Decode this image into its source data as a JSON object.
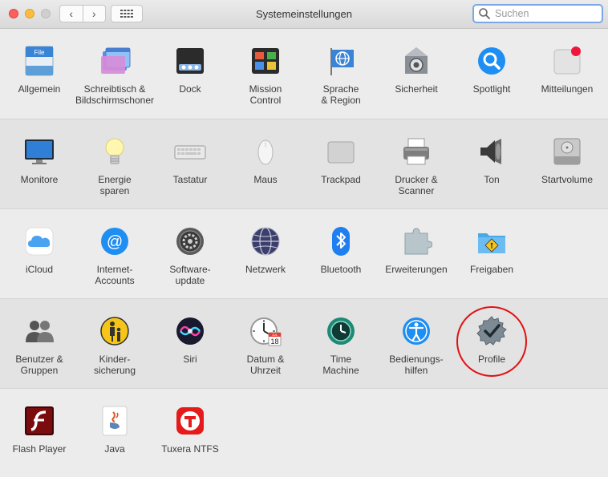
{
  "window": {
    "title": "Systemeinstellungen",
    "back_glyph": "‹",
    "forward_glyph": "›"
  },
  "search": {
    "placeholder": "Suchen",
    "value": ""
  },
  "rows": [
    {
      "items": [
        {
          "name": "allgemein",
          "icon": "general-icon",
          "line1": "Allgemein",
          "line2": ""
        },
        {
          "name": "schreibtisch",
          "icon": "desktop-screensaver-icon",
          "line1": "Schreibtisch &",
          "line2": "Bildschirmschoner"
        },
        {
          "name": "dock",
          "icon": "dock-icon",
          "line1": "Dock",
          "line2": ""
        },
        {
          "name": "mission-control",
          "icon": "mission-control-icon",
          "line1": "Mission",
          "line2": "Control"
        },
        {
          "name": "sprache-region",
          "icon": "language-region-icon",
          "line1": "Sprache",
          "line2": "& Region"
        },
        {
          "name": "sicherheit",
          "icon": "security-icon",
          "line1": "Sicherheit",
          "line2": ""
        },
        {
          "name": "spotlight",
          "icon": "spotlight-icon",
          "line1": "Spotlight",
          "line2": ""
        },
        {
          "name": "mitteilungen",
          "icon": "notifications-icon",
          "line1": "Mitteilungen",
          "line2": ""
        }
      ]
    },
    {
      "items": [
        {
          "name": "monitore",
          "icon": "displays-icon",
          "line1": "Monitore",
          "line2": ""
        },
        {
          "name": "energie-sparen",
          "icon": "energy-saver-icon",
          "line1": "Energie",
          "line2": "sparen"
        },
        {
          "name": "tastatur",
          "icon": "keyboard-icon",
          "line1": "Tastatur",
          "line2": ""
        },
        {
          "name": "maus",
          "icon": "mouse-icon",
          "line1": "Maus",
          "line2": ""
        },
        {
          "name": "trackpad",
          "icon": "trackpad-icon",
          "line1": "Trackpad",
          "line2": ""
        },
        {
          "name": "drucker-scanner",
          "icon": "printer-icon",
          "line1": "Drucker &",
          "line2": "Scanner"
        },
        {
          "name": "ton",
          "icon": "sound-icon",
          "line1": "Ton",
          "line2": ""
        },
        {
          "name": "startvolume",
          "icon": "startup-disk-icon",
          "line1": "Startvolume",
          "line2": ""
        }
      ]
    },
    {
      "items": [
        {
          "name": "icloud",
          "icon": "icloud-icon",
          "line1": "iCloud",
          "line2": ""
        },
        {
          "name": "internet-accounts",
          "icon": "internet-accounts-icon",
          "line1": "Internet-",
          "line2": "Accounts"
        },
        {
          "name": "software-update",
          "icon": "software-update-icon",
          "line1": "Software-",
          "line2": "update"
        },
        {
          "name": "netzwerk",
          "icon": "network-icon",
          "line1": "Netzwerk",
          "line2": ""
        },
        {
          "name": "bluetooth",
          "icon": "bluetooth-icon",
          "line1": "Bluetooth",
          "line2": ""
        },
        {
          "name": "erweiterungen",
          "icon": "extensions-icon",
          "line1": "Erweiterungen",
          "line2": ""
        },
        {
          "name": "freigaben",
          "icon": "sharing-icon",
          "line1": "Freigaben",
          "line2": ""
        }
      ]
    },
    {
      "items": [
        {
          "name": "benutzer-gruppen",
          "icon": "users-groups-icon",
          "line1": "Benutzer &",
          "line2": "Gruppen"
        },
        {
          "name": "kindersicherung",
          "icon": "parental-controls-icon",
          "line1": "Kinder-",
          "line2": "sicherung"
        },
        {
          "name": "siri",
          "icon": "siri-icon",
          "line1": "Siri",
          "line2": ""
        },
        {
          "name": "datum-uhrzeit",
          "icon": "date-time-icon",
          "line1": "Datum &",
          "line2": "Uhrzeit",
          "calendar_month": "JUL",
          "calendar_day": "18"
        },
        {
          "name": "time-machine",
          "icon": "time-machine-icon",
          "line1": "Time",
          "line2": "Machine"
        },
        {
          "name": "bedienungshilfen",
          "icon": "accessibility-icon",
          "line1": "Bedienungs-",
          "line2": "hilfen"
        },
        {
          "name": "profile",
          "icon": "profiles-icon",
          "line1": "Profile",
          "line2": ""
        }
      ]
    },
    {
      "items": [
        {
          "name": "flash-player",
          "icon": "flash-player-icon",
          "line1": "Flash Player",
          "line2": ""
        },
        {
          "name": "java",
          "icon": "java-icon",
          "line1": "Java",
          "line2": ""
        },
        {
          "name": "tuxera-ntfs",
          "icon": "tuxera-ntfs-icon",
          "line1": "Tuxera NTFS",
          "line2": ""
        }
      ]
    }
  ]
}
